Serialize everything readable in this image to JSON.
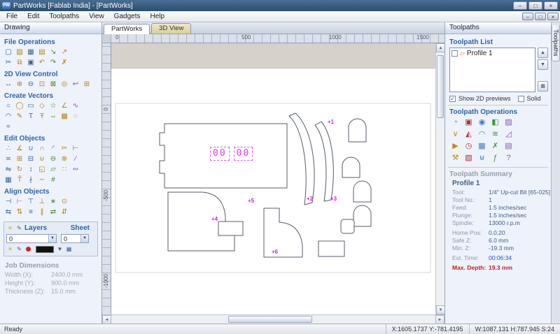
{
  "window": {
    "icon_label": "PW",
    "title": "PartWorks [Fablab India] - [PartWorks]",
    "minimize": "–",
    "maximize": "□",
    "close": "×"
  },
  "menu": {
    "items": [
      "File",
      "Edit",
      "Toolpaths",
      "View",
      "Gadgets",
      "Help"
    ]
  },
  "left_panel": {
    "header": "Drawing",
    "sections": {
      "file_ops": "File Operations",
      "view": "2D View Control",
      "create": "Create Vectors",
      "edit": "Edit Objects",
      "align": "Align Objects"
    },
    "layers": {
      "label": "Layers",
      "value": "0",
      "sheet_label": "Sheet",
      "sheet_value": "0"
    },
    "job_dimensions": {
      "title": "Job Dimensions",
      "rows": [
        {
          "label": "Width  (X):",
          "value": "2400.0 mm"
        },
        {
          "label": "Height (Y):",
          "value": "900.0 mm"
        },
        {
          "label": "Thickness (Z):",
          "value": "15.0 mm"
        }
      ]
    }
  },
  "left_toolbar": {
    "file_ops_row1": [
      "new-file",
      "open-file",
      "save-file",
      "print",
      "import-vectors",
      "export"
    ],
    "file_ops_row2": [
      "cut",
      "copy",
      "paste",
      "undo",
      "redo",
      "delete"
    ],
    "view_row": [
      "pan",
      "zoom-in",
      "zoom-out",
      "zoom-window",
      "zoom-extents",
      "zoom-selected",
      "previous-view",
      "toggle-grid"
    ],
    "create_row1": [
      "draw-circle",
      "draw-ellipse",
      "draw-rectangle",
      "draw-polygon",
      "draw-star",
      "draw-polyline",
      "draw-curve"
    ],
    "create_row2": [
      "draw-arc",
      "draw-freehand",
      "draw-text",
      "text-on-curve",
      "dimension",
      "insert-bitmap",
      "trace-bitmap"
    ],
    "create_row3": [
      "draw-vector-texture"
    ],
    "edit_row1": [
      "node-edit",
      "measure",
      "join-vectors",
      "close-vector",
      "fillet",
      "trim",
      "extend"
    ],
    "edit_row2": [
      "offset",
      "group",
      "ungroup",
      "weld",
      "subtract",
      "intersect",
      "slice"
    ],
    "edit_row3": [
      "mirror",
      "rotate",
      "move",
      "scale",
      "distort",
      "array-copy",
      "paste-along"
    ],
    "edit_row4": [
      "nesting",
      "text-to-curves",
      "break-curve",
      "smooth",
      "snap-options"
    ],
    "align_row1": [
      "align-left",
      "align-right",
      "align-top",
      "align-bottom",
      "align-center",
      "center-in-material"
    ],
    "align_row2": [
      "space-horizontal",
      "space-vertical",
      "align-h-center",
      "align-v-center",
      "mirror-h",
      "mirror-v"
    ]
  },
  "canvas": {
    "tabs": [
      {
        "label": "PartWorks"
      },
      {
        "label": "3D View"
      }
    ],
    "h_ruler": [
      "0",
      "500",
      "1000",
      "1500"
    ],
    "v_ruler": [
      "0",
      "-500",
      "-1000"
    ],
    "engraving_left": "00",
    "engraving_right": "00",
    "labels": [
      "+1",
      "+2",
      "+3",
      "+4",
      "+5",
      "+6"
    ]
  },
  "right_panel": {
    "header": "Toolpaths",
    "list_title": "Toolpath List",
    "toolpath_item": "Profile 1",
    "show_previews": "Show 2D previews",
    "solid": "Solid",
    "ops_title": "Toolpath Operations",
    "summary": {
      "title": "Toolpath Summary",
      "name": "Profile 1",
      "rows": [
        {
          "label": "Tool:",
          "value": "1/4\" Up-cut Bit [65-025]"
        },
        {
          "label": "Tool No.:",
          "value": "1"
        },
        {
          "label": "Feed:",
          "value": "1.5 inches/sec"
        },
        {
          "label": "Plunge:",
          "value": "1.5 inches/sec"
        },
        {
          "label": "Spindle:",
          "value": "13000 r.p.m"
        },
        {
          "label": "Home Pos:",
          "value": "0,0,20"
        },
        {
          "label": "Safe Z:",
          "value": "6.0 mm"
        },
        {
          "label": "Min. Z:",
          "value": "-19.3 mm"
        },
        {
          "label": "Est. Time:",
          "value": "00:06:34"
        },
        {
          "label": "Max. Depth:",
          "value": "19.3 mm"
        }
      ]
    }
  },
  "right_toolbar": {
    "op_row1": [
      "profile-toolpath",
      "pocket-toolpath",
      "drill-toolpath",
      "inlay-toolpath",
      "texture-toolpath"
    ],
    "op_row2": [
      "vcarve-toolpath",
      "prism-toolpath",
      "moulding-toolpath",
      "fluting-toolpath",
      "chamfer-toolpath"
    ],
    "op_row3": [
      "preview-toolpaths",
      "estimate-time",
      "save-toolpath",
      "delete-toolpath",
      "toolpath-template"
    ],
    "op_row4": [
      "tool-database",
      "material-setup",
      "merge-toolpaths",
      "document-variables",
      "toolpath-help"
    ]
  },
  "side_tab": "Toolpaths",
  "status_bar": {
    "left": "Ready",
    "coords": "X:1605.1737 Y:-781.4195",
    "dims": "W:1087.131  H:787.945  S:24"
  },
  "glyphs": {
    "check": "✓",
    "up": "▲",
    "down": "▼",
    "left": "◄",
    "right": "►",
    "dropdown": "▼",
    "lamp": "☀",
    "pencil": "✎",
    "calc": "▦",
    "list_item": "▱"
  },
  "icon_glyphs": {
    "new-file": "▢",
    "open-file": "▨",
    "save-file": "▦",
    "print": "▤",
    "import-vectors": "↘",
    "export": "↗",
    "cut": "✂",
    "copy": "⧉",
    "paste": "▣",
    "undo": "↶",
    "redo": "↷",
    "delete": "✗",
    "pan": "↔",
    "zoom-in": "⊕",
    "zoom-out": "⊖",
    "zoom-window": "⊡",
    "zoom-extents": "⊠",
    "zoom-selected": "◎",
    "previous-view": "↩",
    "toggle-grid": "⊞",
    "draw-circle": "○",
    "draw-ellipse": "◯",
    "draw-rectangle": "▭",
    "draw-polygon": "◇",
    "draw-star": "☆",
    "draw-polyline": "∠",
    "draw-curve": "∿",
    "draw-arc": "◠",
    "draw-freehand": "✎",
    "draw-text": "T",
    "text-on-curve": "Ŧ",
    "dimension": "⇔",
    "insert-bitmap": "▩",
    "trace-bitmap": "◌",
    "draw-vector-texture": "≈",
    "node-edit": "∴",
    "measure": "∡",
    "join-vectors": "∪",
    "close-vector": "∩",
    "fillet": "◜",
    "trim": "✂",
    "extend": "⊢",
    "offset": "≍",
    "group": "⊞",
    "ungroup": "⊟",
    "weld": "⊍",
    "subtract": "⊖",
    "intersect": "⊗",
    "slice": "∕",
    "mirror": "⇋",
    "rotate": "↻",
    "move": "↕",
    "scale": "◱",
    "distort": "▱",
    "array-copy": "∷",
    "paste-along": "∾",
    "nesting": "▦",
    "text-to-curves": "Ť",
    "break-curve": "∤",
    "smooth": "∼",
    "snap-options": "#",
    "align-left": "⊣",
    "align-right": "⊢",
    "align-top": "⊤",
    "align-bottom": "⊥",
    "align-center": "∗",
    "center-in-material": "⊙",
    "space-horizontal": "⇆",
    "space-vertical": "⇅",
    "align-h-center": "≡",
    "align-v-center": "∥",
    "mirror-h": "⇄",
    "mirror-v": "⇵",
    "profile-toolpath": "◔",
    "pocket-toolpath": "▣",
    "drill-toolpath": "◉",
    "inlay-toolpath": "◧",
    "texture-toolpath": "▨",
    "vcarve-toolpath": "∨",
    "prism-toolpath": "◭",
    "moulding-toolpath": "◠",
    "fluting-toolpath": "≋",
    "chamfer-toolpath": "◿",
    "preview-toolpaths": "▶",
    "estimate-time": "◷",
    "save-toolpath": "▦",
    "delete-toolpath": "✗",
    "toolpath-template": "▤",
    "tool-database": "⚒",
    "material-setup": "▧",
    "merge-toolpaths": "⊎",
    "document-variables": "ƒ",
    "toolpath-help": "?"
  }
}
